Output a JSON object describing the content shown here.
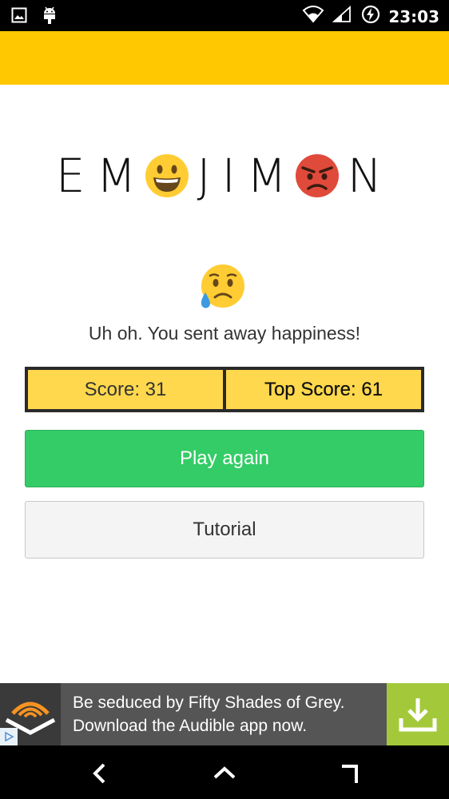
{
  "status_bar": {
    "time": "23:03",
    "icons": [
      "image-icon",
      "android-icon",
      "wifi-icon",
      "signal-icon",
      "battery-charging-icon"
    ]
  },
  "colors": {
    "header": "#ffc800",
    "score_box": "#ffd84d",
    "play_button": "#33cc66",
    "ad_download": "#a3c93a"
  },
  "logo": {
    "part1": "EM",
    "part2": "JIM",
    "part3": "N",
    "emojis": [
      "grinning-face-icon",
      "angry-face-icon"
    ]
  },
  "result": {
    "emoji": "disappointed-relieved-face-icon",
    "message": "Uh oh. You sent away happiness!"
  },
  "scores": {
    "score": "Score: 31",
    "top_score": "Top Score: 61"
  },
  "buttons": {
    "play_again": "Play again",
    "tutorial": "Tutorial"
  },
  "ad": {
    "line1": "Be seduced by Fifty Shades of Grey.",
    "line2": "Download the Audible app now."
  },
  "nav": {
    "icons": [
      "back-icon",
      "home-icon",
      "recents-icon"
    ]
  }
}
